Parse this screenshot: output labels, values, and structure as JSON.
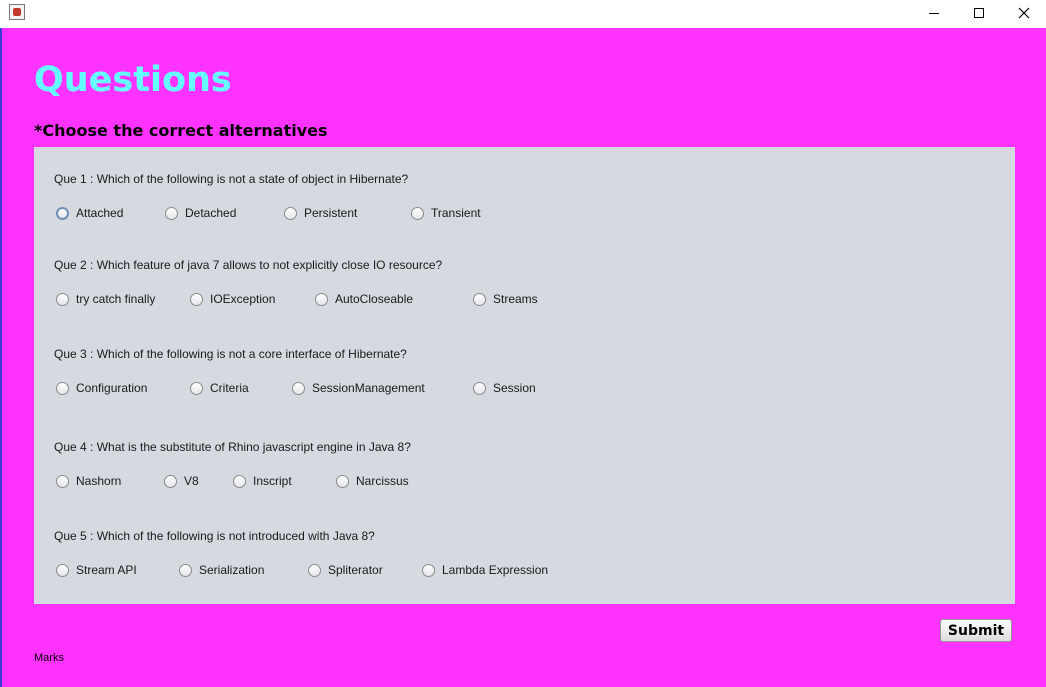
{
  "window": {
    "app_icon": "java-coffee-icon",
    "controls": [
      "minimize-icon",
      "maximize-icon",
      "close-icon"
    ]
  },
  "heading": "Questions",
  "subheading": "*Choose the correct alternatives",
  "questions": [
    {
      "text": "Que 1 : Which of the following is not a state of object in Hibernate?",
      "options": [
        "Attached",
        "Detached",
        "Persistent",
        "Transient"
      ]
    },
    {
      "text": "Que 2 : Which feature of java 7 allows to not explicitly close IO resource?",
      "options": [
        "try catch finally",
        "IOException",
        "AutoCloseable",
        "Streams"
      ]
    },
    {
      "text": "Que 3 :  Which of the following is not a core interface of Hibernate?",
      "options": [
        "Configuration",
        "Criteria",
        "SessionManagement",
        "Session"
      ]
    },
    {
      "text": "Que 4 :  What is the substitute of Rhino javascript engine in Java 8?",
      "options": [
        "Nashorn",
        "V8",
        "Inscript",
        "Narcissus"
      ]
    },
    {
      "text": "Que 5 :  Which of the following is not introduced with Java 8?",
      "options": [
        "Stream API",
        "Serialization",
        "Spliterator",
        "Lambda Expression"
      ]
    }
  ],
  "submit_label": "Submit",
  "marks_label": "Marks",
  "colors": {
    "background": "#ff33ff",
    "heading": "#66ffff",
    "panel": "#d6d9df"
  }
}
